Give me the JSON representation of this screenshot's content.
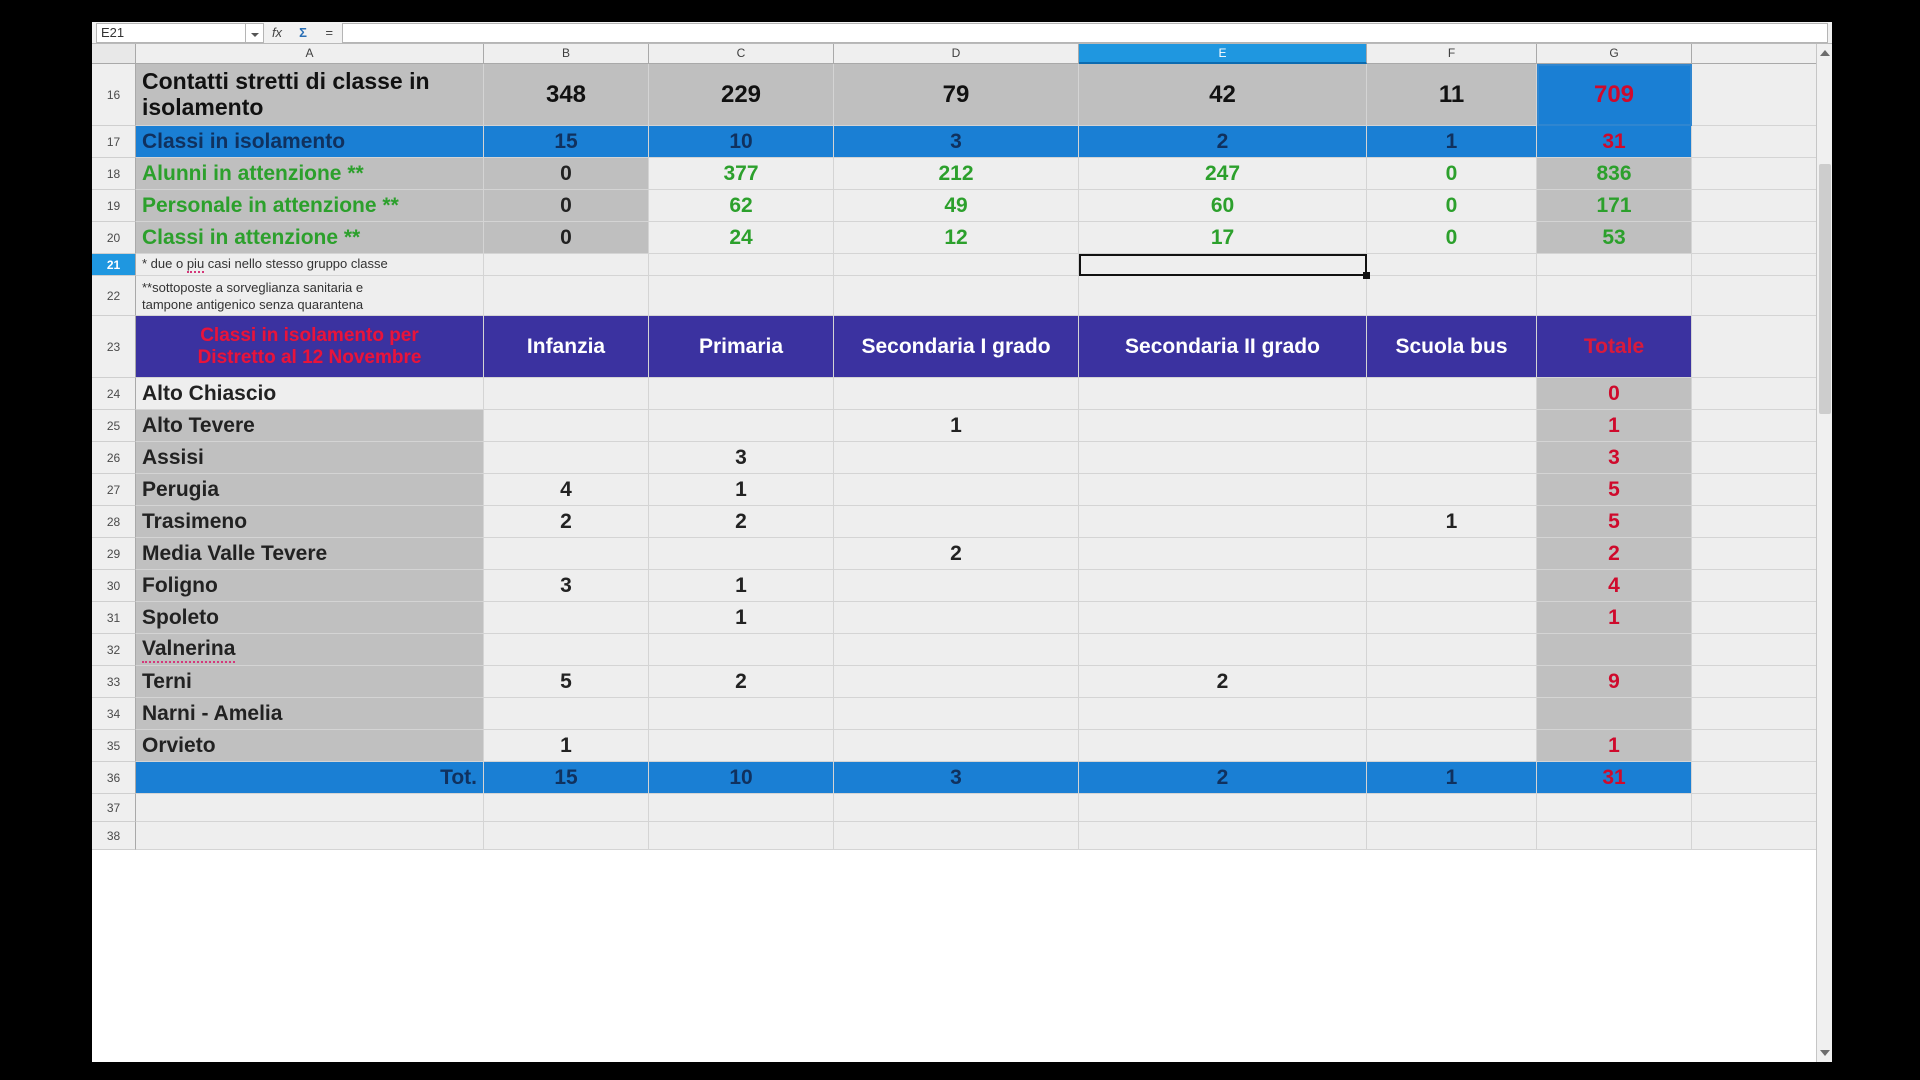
{
  "app": {
    "formula_bar": {
      "name_box_value": "E21",
      "fx_label": "fx",
      "sum_icon": "sum-icon",
      "equals_icon": "=",
      "formula_value": ""
    }
  },
  "grid": {
    "column_headers": [
      "A",
      "B",
      "C",
      "D",
      "E",
      "F",
      "G"
    ],
    "selected_column": "E",
    "selected_row": "21",
    "row_numbers": [
      "16",
      "17",
      "18",
      "19",
      "20",
      "21",
      "22",
      "23",
      "24",
      "25",
      "26",
      "27",
      "28",
      "29",
      "30",
      "31",
      "32",
      "33",
      "34",
      "35",
      "36",
      "37",
      "38"
    ]
  },
  "summary": {
    "rows": [
      {
        "row": "16",
        "label": "Contatti stretti di classe in isolamento",
        "b": "348",
        "c": "229",
        "d": "79",
        "e": "42",
        "f": "11",
        "g": "709"
      },
      {
        "row": "17",
        "label": "Classi in isolamento",
        "b": "15",
        "c": "10",
        "d": "3",
        "e": "2",
        "f": "1",
        "g": "31"
      },
      {
        "row": "18",
        "label": "Alunni in attenzione  **",
        "b": "0",
        "c": "377",
        "d": "212",
        "e": "247",
        "f": "0",
        "g": "836"
      },
      {
        "row": "19",
        "label": "Personale in attenzione **",
        "b": "0",
        "c": "62",
        "d": "49",
        "e": "60",
        "f": "0",
        "g": "171"
      },
      {
        "row": "20",
        "label": "Classi in attenzione **",
        "b": "0",
        "c": "24",
        "d": "12",
        "e": "17",
        "f": "0",
        "g": "53"
      }
    ]
  },
  "footnotes": {
    "row21": "* due o piu casi  nello stesso gruppo classe",
    "row21_parts": {
      "before": "* due o ",
      "misspelled": "piu",
      "after": " casi  nello stesso gruppo classe"
    },
    "row22_line1": "**sottoposte a sorveglianza sanitaria e",
    "row22_line2": "tampone antigenico senza quarantena"
  },
  "district_table": {
    "title_line1": "Classi in isolamento per",
    "title_line2": "Distretto al 12 Novembre",
    "headers": [
      "Infanzia",
      "Primaria",
      "Secondaria I grado",
      "Secondaria II grado",
      "Scuola bus",
      "Totale"
    ],
    "rows": [
      {
        "row": "24",
        "name": "Alto Chiascio",
        "infanzia": "",
        "primaria": "",
        "sec1": "",
        "sec2": "",
        "bus": "",
        "totale": "0"
      },
      {
        "row": "25",
        "name": "Alto Tevere",
        "infanzia": "",
        "primaria": "",
        "sec1": "1",
        "sec2": "",
        "bus": "",
        "totale": "1"
      },
      {
        "row": "26",
        "name": "Assisi",
        "infanzia": "",
        "primaria": "3",
        "sec1": "",
        "sec2": "",
        "bus": "",
        "totale": "3"
      },
      {
        "row": "27",
        "name": "Perugia",
        "infanzia": "4",
        "primaria": "1",
        "sec1": "",
        "sec2": "",
        "bus": "",
        "totale": "5"
      },
      {
        "row": "28",
        "name": "Trasimeno",
        "infanzia": "2",
        "primaria": "2",
        "sec1": "",
        "sec2": "",
        "bus": "1",
        "totale": "5"
      },
      {
        "row": "29",
        "name": "Media Valle Tevere",
        "infanzia": "",
        "primaria": "",
        "sec1": "2",
        "sec2": "",
        "bus": "",
        "totale": "2"
      },
      {
        "row": "30",
        "name": "Foligno",
        "infanzia": "3",
        "primaria": "1",
        "sec1": "",
        "sec2": "",
        "bus": "",
        "totale": "4"
      },
      {
        "row": "31",
        "name": "Spoleto",
        "infanzia": "",
        "primaria": "1",
        "sec1": "",
        "sec2": "",
        "bus": "",
        "totale": "1"
      },
      {
        "row": "32",
        "name": "Valnerina",
        "infanzia": "",
        "primaria": "",
        "sec1": "",
        "sec2": "",
        "bus": "",
        "totale": ""
      },
      {
        "row": "33",
        "name": "Terni",
        "infanzia": "5",
        "primaria": "2",
        "sec1": "",
        "sec2": "2",
        "bus": "",
        "totale": "9"
      },
      {
        "row": "34",
        "name": "Narni - Amelia",
        "infanzia": "",
        "primaria": "",
        "sec1": "",
        "sec2": "",
        "bus": "",
        "totale": ""
      },
      {
        "row": "35",
        "name": "Orvieto",
        "infanzia": "1",
        "primaria": "",
        "sec1": "",
        "sec2": "",
        "bus": "",
        "totale": "1"
      }
    ],
    "total_row": {
      "row": "36",
      "label": "Tot.",
      "infanzia": "15",
      "primaria": "10",
      "sec1": "3",
      "sec2": "2",
      "bus": "1",
      "totale": "31"
    }
  },
  "colors": {
    "accent_blue": "#1a7fd4",
    "header_purple": "#3b32a0",
    "title_red": "#e8133c",
    "total_red": "#cf0a2c",
    "attention_green": "#2ca02c",
    "grey_fill": "#bfbfbf"
  }
}
